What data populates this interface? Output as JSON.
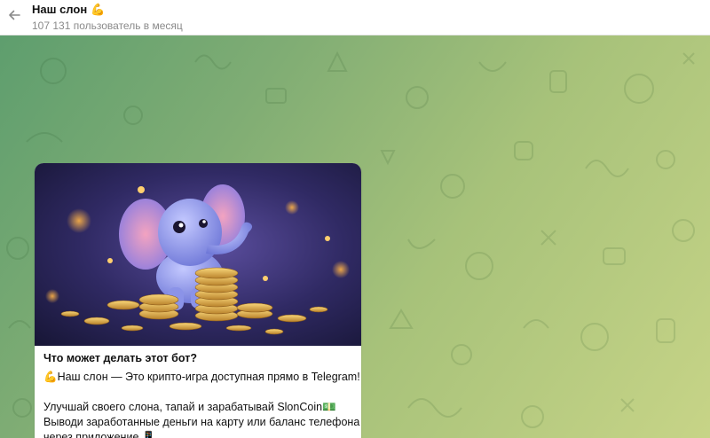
{
  "header": {
    "title": "Наш слон",
    "title_emoji": "💪",
    "subtitle": "107 131 пользователь в месяц",
    "back_icon": "arrow-left-icon"
  },
  "message": {
    "title": "Что может делать этот бот?",
    "line1_emoji": "💪",
    "line1": "Наш слон — Это крипто-игра доступная прямо в Telegram!",
    "line2": "Улучшай своего слона, тапай и зарабатывай SlonCoin",
    "line2_emoji": "💵",
    "line3": "Выводи заработанные деньги на карту или баланс телефона",
    "line4": "через приложение",
    "line4_emoji": "📱"
  },
  "colors": {
    "chat_bg_start": "#5e9e6e",
    "chat_bg_end": "#c7d487",
    "bubble": "#ffffff"
  }
}
